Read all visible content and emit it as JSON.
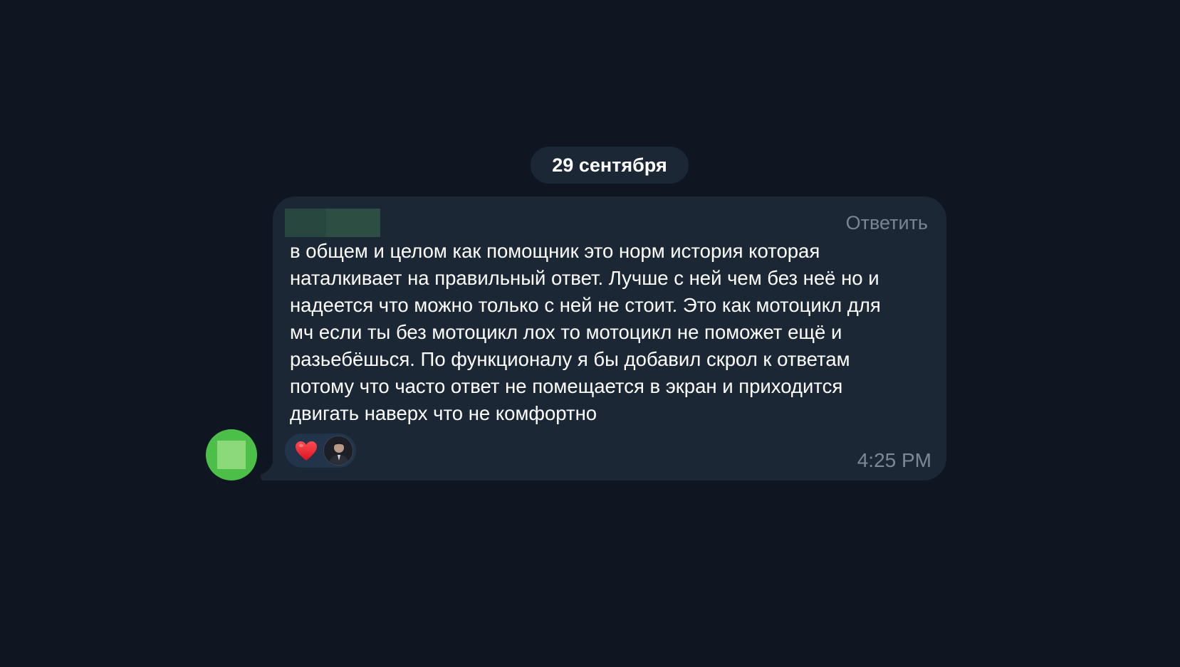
{
  "date_divider": {
    "label": "29 сентября"
  },
  "message": {
    "reply_label": "Ответить",
    "text": "в общем и целом как помощник это норм история которая\nнаталкивает на правильный ответ. Лучше с ней чем без неё но и\nнадеется что можно только с ней не стоит. Это как мотоцикл для\nмч если ты без мотоцикл лох то мотоцикл не поможет ещё и\nразьебёшься. По функционалу я бы добавил скрол к ответам\nпотому что часто ответ не помещается в экран и приходится\nдвигать наверх что не комфортно",
    "time": "4:25 PM",
    "reactions": [
      {
        "icon": "heart-icon",
        "reactor_avatar": "reactor-avatar"
      }
    ]
  },
  "colors": {
    "background": "#0f1621",
    "bubble": "#1b2735",
    "reply_text": "#7a8591",
    "timestamp": "#7d8894",
    "avatar": "#4cbf49",
    "heart": "#e8262f"
  }
}
